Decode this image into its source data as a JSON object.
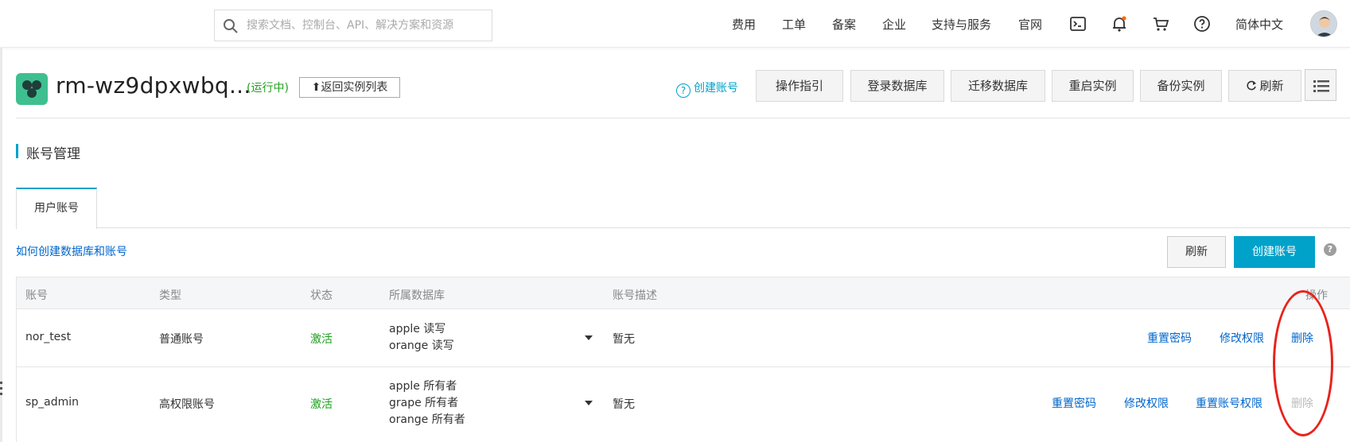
{
  "topbar": {
    "search_placeholder": "搜索文档、控制台、API、解决方案和资源",
    "nav": [
      "费用",
      "工单",
      "备案",
      "企业",
      "支持与服务",
      "官网"
    ],
    "language": "简体中文",
    "icons": [
      "terminal-icon",
      "bell-icon",
      "cart-icon",
      "help-icon"
    ]
  },
  "instance": {
    "title": "rm-wz9dpxwbq...",
    "status": "(运行中)",
    "back_label": "⬆返回实例列表",
    "create_account_link": "创建账号",
    "buttons": [
      "操作指引",
      "登录数据库",
      "迁移数据库",
      "重启实例",
      "备份实例"
    ],
    "refresh_label": "刷新"
  },
  "section": {
    "title": "账号管理",
    "tab": "用户账号",
    "howto_link": "如何创建数据库和账号",
    "refresh_button": "刷新",
    "create_button": "创建账号",
    "help": "?"
  },
  "table": {
    "headers": [
      "账号",
      "类型",
      "状态",
      "所属数据库",
      "账号描述",
      "操作"
    ],
    "rows": [
      {
        "account": "nor_test",
        "type": "普通账号",
        "status": "激活",
        "databases": [
          "apple 读写",
          "orange 读写"
        ],
        "description": "暂无",
        "actions": [
          "重置密码",
          "修改权限",
          "删除"
        ]
      },
      {
        "account": "sp_admin",
        "type": "高权限账号",
        "status": "激活",
        "databases": [
          "apple 所有者",
          "grape 所有者",
          "orange 所有者"
        ],
        "description": "暂无",
        "actions": [
          "重置密码",
          "修改权限",
          "重置账号权限",
          "删除"
        ]
      }
    ]
  },
  "colors": {
    "accent": "#00a2ca",
    "link": "#0066cc",
    "active_green": "#1a9e1a",
    "annotation_red": "#e8231b",
    "logo_green": "#3fbf8f"
  }
}
